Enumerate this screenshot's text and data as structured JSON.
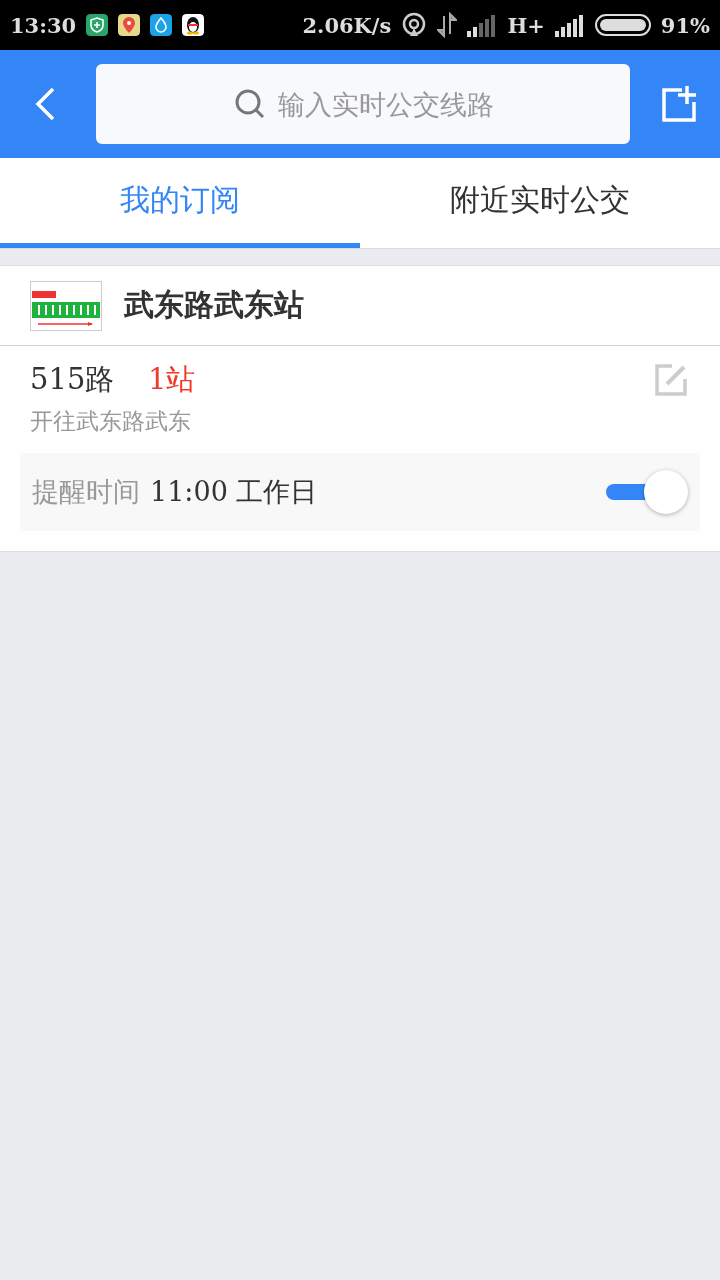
{
  "status_bar": {
    "time": "13:30",
    "speed": "2.06K/s",
    "network": "H+",
    "battery": "91%"
  },
  "header": {
    "search": {
      "placeholder": "输入实时公交线路"
    }
  },
  "tabs": [
    {
      "label": "我的订阅",
      "selected": true
    },
    {
      "label": "附近实时公交",
      "selected": false
    }
  ],
  "station": {
    "name": "武东路武东站"
  },
  "routes": [
    {
      "route": "515路",
      "stops": "1站",
      "direction": "开往武东路武东",
      "reminder_label": "提醒时间",
      "reminder_value": "11:00 工作日",
      "on": true
    }
  ]
}
